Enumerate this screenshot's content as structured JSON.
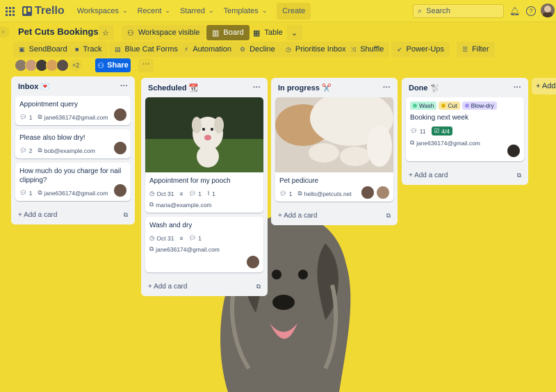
{
  "topnav": {
    "logo": "Trello",
    "menus": [
      "Workspaces",
      "Recent",
      "Starred",
      "Templates"
    ],
    "create_label": "Create",
    "search_placeholder": "Search"
  },
  "board": {
    "title": "Pet Cuts Bookings",
    "visibility_label": "Workspace visible",
    "view_board": "Board",
    "view_table": "Table"
  },
  "powerups": [
    {
      "label": "SendBoard",
      "icon": "sendboard-icon"
    },
    {
      "label": "Track",
      "icon": "track-icon"
    },
    {
      "label": "Blue Cat Forms",
      "icon": "form-icon"
    },
    {
      "label": "Automation",
      "icon": "lightning-icon"
    },
    {
      "label": "Decline",
      "icon": "gear-icon"
    },
    {
      "label": "Prioritise Inbox",
      "icon": "clock-icon"
    },
    {
      "label": "Shuffle",
      "icon": "shuffle-icon"
    },
    {
      "label": "Power-Ups",
      "icon": "rocket-icon"
    },
    {
      "label": "Filter",
      "icon": "filter-icon"
    }
  ],
  "members": {
    "extra_count": "+2",
    "share_label": "Share"
  },
  "lists": [
    {
      "title": "Inbox 💌",
      "cards": [
        {
          "title": "Appointment query",
          "comments": "1",
          "email": "jane636174@gmail.com"
        },
        {
          "title": "Please also blow dry!",
          "comments": "2",
          "email": "bob@example.com"
        },
        {
          "title": "How much do you charge for nail clipping?",
          "comments": "1",
          "email": "jane636174@gmail.com"
        }
      ],
      "add_label": "Add a card"
    },
    {
      "title": "Scheduled 📆",
      "cards": [
        {
          "title": "Appointment for my pooch",
          "date": "Oct 31",
          "comments": "1",
          "attachments": "1",
          "email": "maria@example.com"
        },
        {
          "title": "Wash and dry",
          "date": "Oct 31",
          "comments": "1",
          "email": "jane636174@gmail.com"
        }
      ],
      "add_label": "Add a card"
    },
    {
      "title": "In progress ✂️",
      "cards": [
        {
          "title": "Pet pedicure",
          "comments": "1",
          "email": "hello@petcuts.net"
        }
      ],
      "add_label": "Add a card"
    },
    {
      "title": "Done 🐩",
      "cards": [
        {
          "title": "Booking next week",
          "labels": [
            "Wash",
            "Cut",
            "Blow-dry"
          ],
          "comments": "11",
          "checklist": "4/4",
          "email": "jane636174@gmail.com"
        }
      ],
      "add_label": "Add a card"
    }
  ],
  "add_list_label": "+ Add another list",
  "colors": {
    "background": "#f1d934",
    "share": "#0c66e4",
    "label_wash": "#4bce97",
    "label_cut": "#e2b203",
    "label_blowdry": "#9f8fef",
    "checklist": "#1f845a"
  }
}
